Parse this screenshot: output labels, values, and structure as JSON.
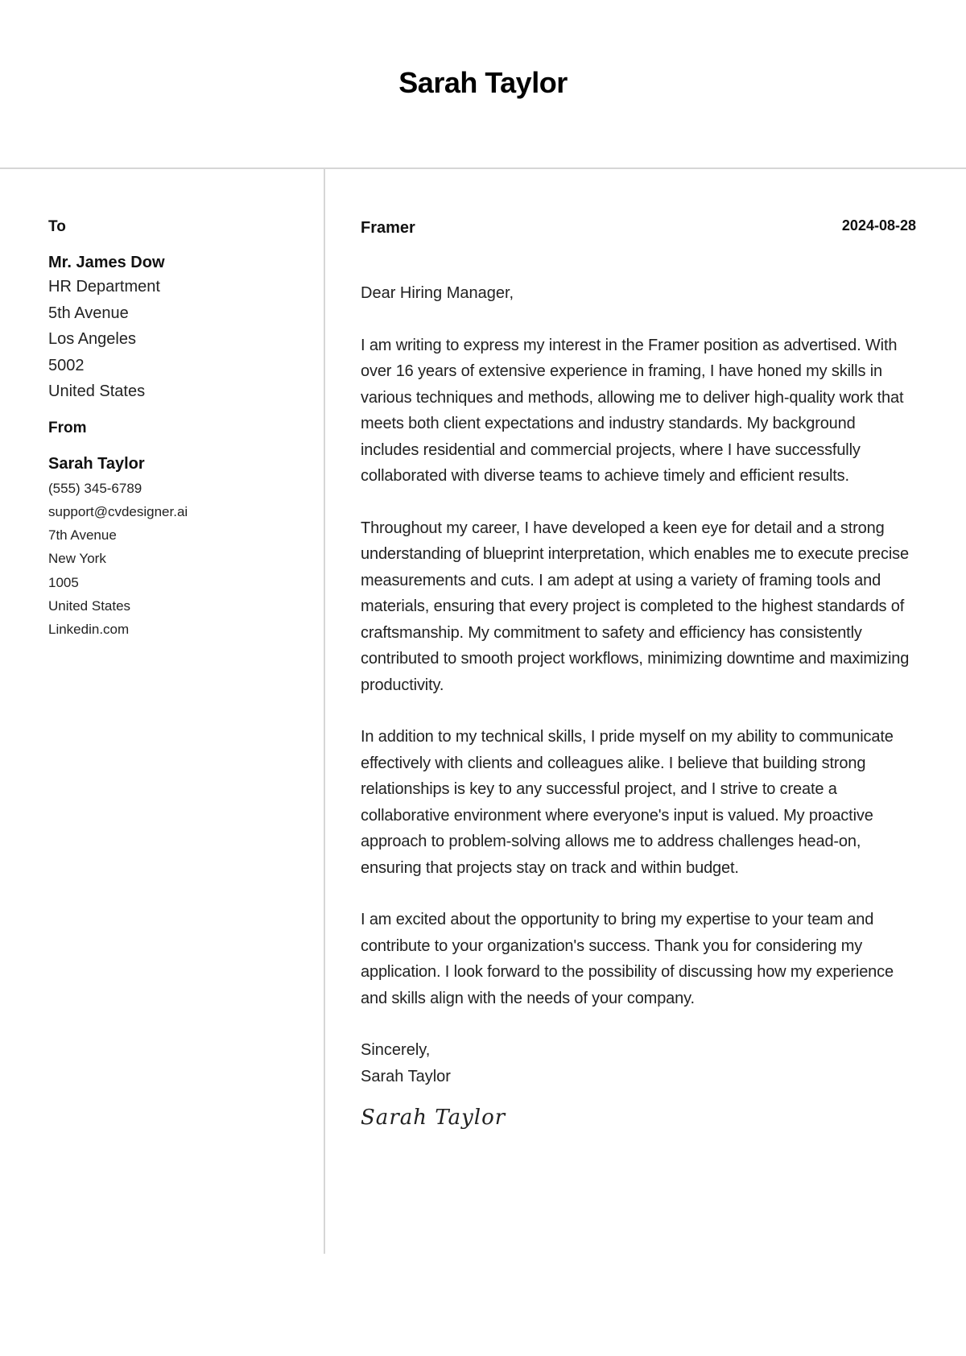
{
  "header": {
    "name": "Sarah Taylor"
  },
  "sidebar": {
    "to": {
      "label": "To",
      "name": "Mr. James Dow",
      "lines": [
        "HR Department",
        "5th Avenue",
        "Los Angeles",
        "5002",
        "United States"
      ]
    },
    "from": {
      "label": "From",
      "name": "Sarah Taylor",
      "phone": "(555) 345-6789",
      "email": "support@cvdesigner.ai",
      "street": "7th Avenue",
      "city": "New York",
      "zip": "1005",
      "country": "United States",
      "website": "Linkedin.com"
    }
  },
  "letter": {
    "job_title": "Framer",
    "date": "2024-08-28",
    "greeting": "Dear Hiring Manager,",
    "paragraphs": [
      "I am writing to express my interest in the Framer position as advertised. With over 16 years of extensive experience in framing, I have honed my skills in various techniques and methods, allowing me to deliver high-quality work that meets both client expectations and industry standards. My background includes residential and commercial projects, where I have successfully collaborated with diverse teams to achieve timely and efficient results.",
      "Throughout my career, I have developed a keen eye for detail and a strong understanding of blueprint interpretation, which enables me to execute precise measurements and cuts. I am adept at using a variety of framing tools and materials, ensuring that every project is completed to the highest standards of craftsmanship. My commitment to safety and efficiency has consistently contributed to smooth project workflows, minimizing downtime and maximizing productivity.",
      "In addition to my technical skills, I pride myself on my ability to communicate effectively with clients and colleagues alike. I believe that building strong relationships is key to any successful project, and I strive to create a collaborative environment where everyone's input is valued. My proactive approach to problem-solving allows me to address challenges head-on, ensuring that projects stay on track and within budget.",
      "I am excited about the opportunity to bring my expertise to your team and contribute to your organization's success. Thank you for considering my application. I look forward to the possibility of discussing how my experience and skills align with the needs of your company."
    ],
    "closing": "Sincerely,",
    "closing_name": "Sarah Taylor",
    "signature": "Sarah Taylor"
  }
}
